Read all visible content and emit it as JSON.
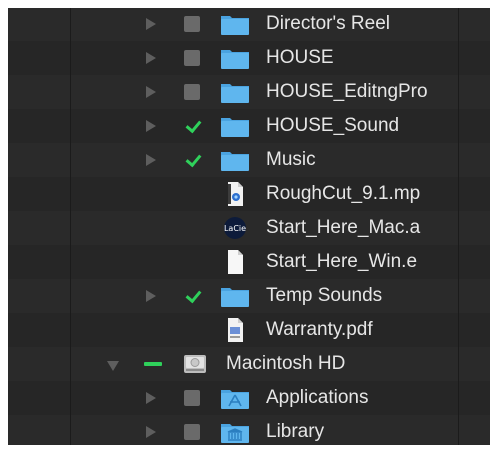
{
  "items": [
    {
      "name": "Director's Reel",
      "kind": "folder",
      "checkbox": "empty",
      "disclosure": "closed",
      "indent": 1
    },
    {
      "name": "HOUSE",
      "kind": "folder",
      "checkbox": "empty",
      "disclosure": "closed",
      "indent": 1
    },
    {
      "name": "HOUSE_EditngPro",
      "kind": "folder",
      "checkbox": "empty",
      "disclosure": "closed",
      "indent": 1
    },
    {
      "name": "HOUSE_Sound",
      "kind": "folder",
      "checkbox": "checked",
      "disclosure": "closed",
      "indent": 1
    },
    {
      "name": "Music",
      "kind": "folder",
      "checkbox": "checked",
      "disclosure": "closed",
      "indent": 1
    },
    {
      "name": "RoughCut_9.1.mp",
      "kind": "video-file",
      "checkbox": "none",
      "disclosure": "none",
      "indent": 1
    },
    {
      "name": "Start_Here_Mac.a",
      "kind": "lacie-app",
      "checkbox": "none",
      "disclosure": "none",
      "indent": 1
    },
    {
      "name": "Start_Here_Win.e",
      "kind": "document-file",
      "checkbox": "none",
      "disclosure": "none",
      "indent": 1
    },
    {
      "name": "Temp Sounds",
      "kind": "folder",
      "checkbox": "checked",
      "disclosure": "closed",
      "indent": 1
    },
    {
      "name": "Warranty.pdf",
      "kind": "pdf-file",
      "checkbox": "none",
      "disclosure": "none",
      "indent": 1
    },
    {
      "name": "Macintosh HD",
      "kind": "disk",
      "checkbox": "mixed",
      "disclosure": "open",
      "indent": 0
    },
    {
      "name": "Applications",
      "kind": "applications-folder",
      "checkbox": "empty",
      "disclosure": "closed",
      "indent": 1
    },
    {
      "name": "Library",
      "kind": "library-folder",
      "checkbox": "empty",
      "disclosure": "closed",
      "indent": 1
    }
  ],
  "colors": {
    "background": "#262626",
    "text": "#e6e6e6",
    "check_green": "#2fd15b",
    "folder_blue": "#5fb6ee"
  }
}
